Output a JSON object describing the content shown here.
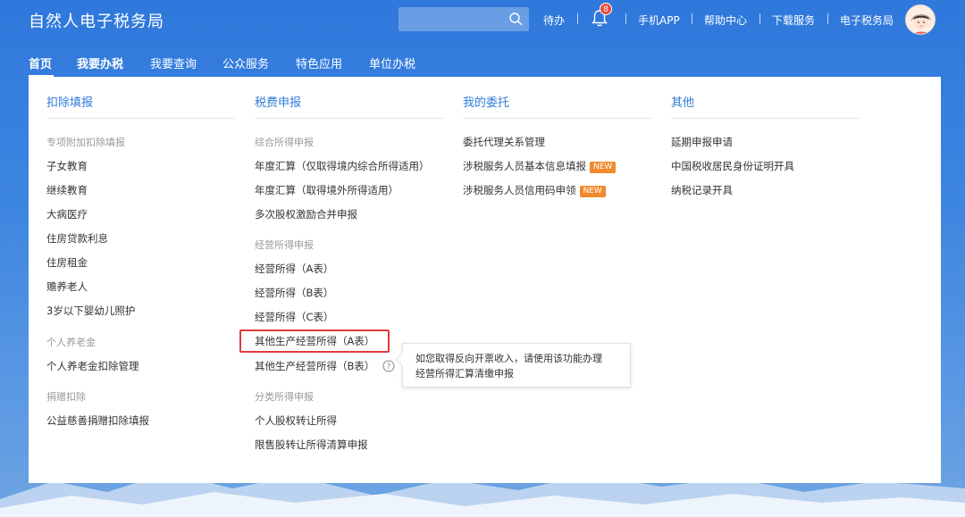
{
  "app": {
    "title": "自然人电子税务局"
  },
  "header": {
    "search": {
      "placeholder": ""
    },
    "links": {
      "todo": "待办",
      "notification_count": "8",
      "mobile_app": "手机APP",
      "help_center": "帮助中心",
      "download": "下载服务",
      "e_tax_bureau": "电子税务局"
    }
  },
  "nav": {
    "items": [
      "首页",
      "我要办税",
      "我要查询",
      "公众服务",
      "特色应用",
      "单位办税"
    ]
  },
  "menu": {
    "deduction": {
      "title": "扣除填报",
      "group1": "专项附加扣除填报",
      "group1_items": [
        "子女教育",
        "继续教育",
        "大病医疗",
        "住房贷款利息",
        "住房租金",
        "赡养老人",
        "3岁以下婴幼儿照护"
      ],
      "group2": "个人养老金",
      "group2_items": [
        "个人养老金扣除管理"
      ],
      "group3": "捐赠扣除",
      "group3_items": [
        "公益慈善捐赠扣除填报"
      ]
    },
    "tax_declaration": {
      "title": "税费申报",
      "group1": "综合所得申报",
      "group1_items": [
        "年度汇算（仅取得境内综合所得适用）",
        "年度汇算（取得境外所得适用）",
        "多次股权激励合并申报"
      ],
      "group2": "经营所得申报",
      "group2_items": [
        "经营所得（A表）",
        "经营所得（B表）",
        "经营所得（C表）",
        "其他生产经营所得（A表）",
        "其他生产经营所得（B表）"
      ],
      "group3": "分类所得申报",
      "group3_items": [
        "个人股权转让所得",
        "限售股转让所得清算申报"
      ]
    },
    "delegation": {
      "title": "我的委托",
      "items": [
        "委托代理关系管理",
        "涉税服务人员基本信息填报",
        "涉税服务人员信用码申领"
      ],
      "new_badge": "NEW"
    },
    "other": {
      "title": "其他",
      "items": [
        "延期申报申请",
        "中国税收居民身份证明开具",
        "纳税记录开具"
      ]
    }
  },
  "tooltip": {
    "line1": "如您取得反向开票收入，请使用该功能办理",
    "line2": "经营所得汇算清缴申报"
  },
  "colors": {
    "accent": "#2f7bd6",
    "highlight_border": "#e23b3b",
    "new_badge": "#f08a2c"
  }
}
